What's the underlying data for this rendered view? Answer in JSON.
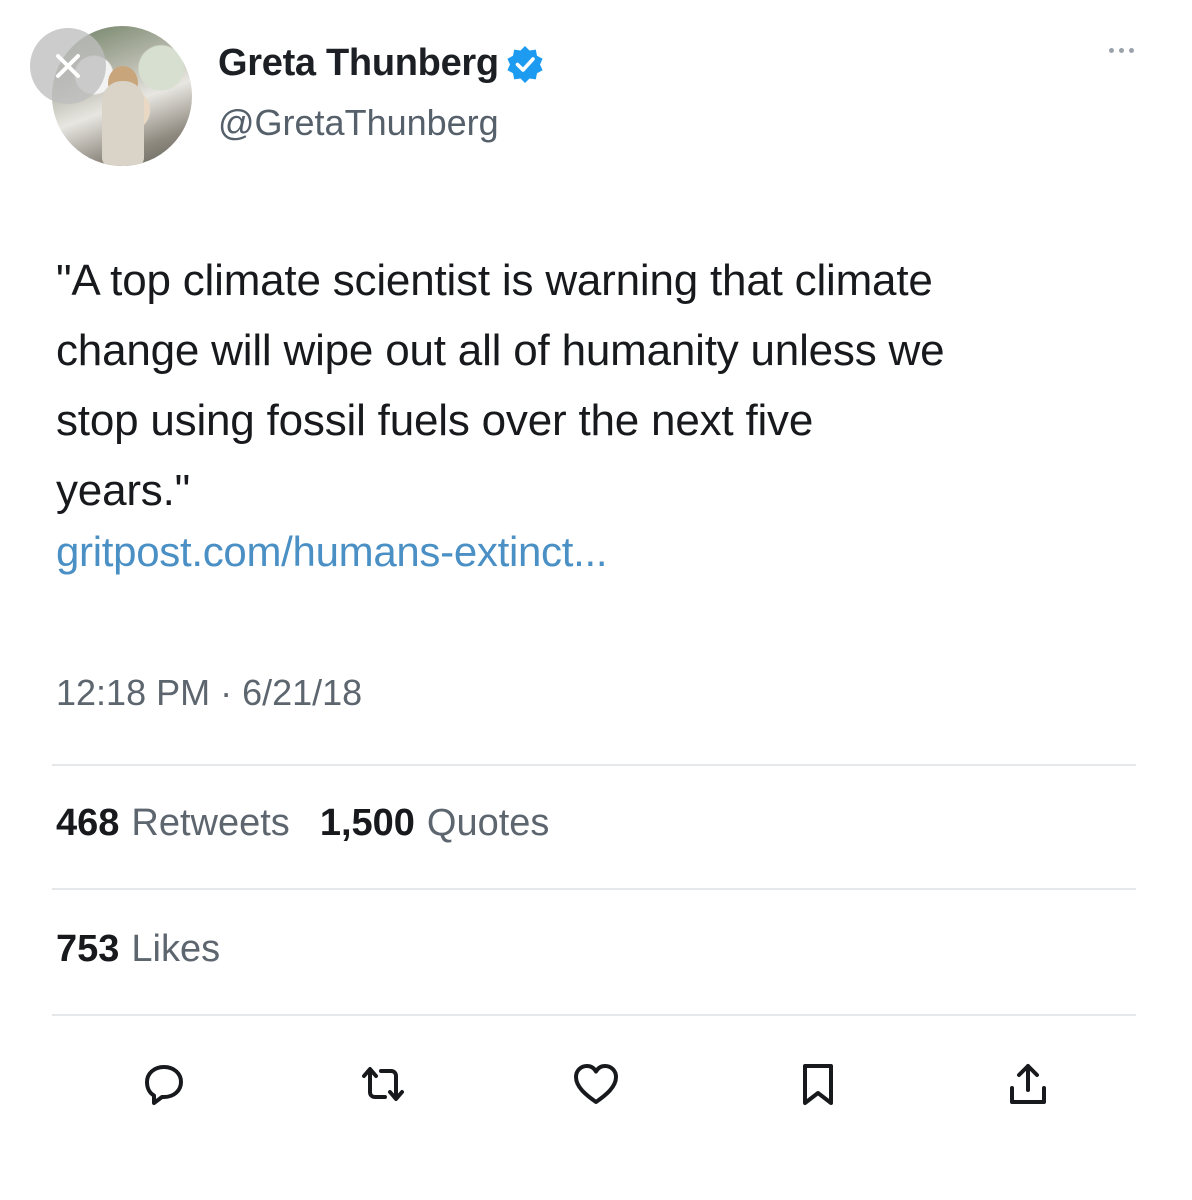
{
  "author": {
    "display_name": "Greta Thunberg",
    "handle": "@GretaThunberg",
    "verified": true
  },
  "tweet": {
    "text_lines": [
      "\"A top climate scientist is warning that climate",
      "change will wipe out all of humanity unless we",
      "stop using fossil fuels over the next five",
      "years.\""
    ],
    "link": "gritpost.com/humans-extinct...",
    "time": "12:18 PM",
    "date_separator": " · ",
    "date": "6/21/18"
  },
  "stats": {
    "retweets_count": "468",
    "retweets_label": "Retweets",
    "quotes_count": "1,500",
    "quotes_label": "Quotes",
    "likes_count": "753",
    "likes_label": "Likes"
  },
  "icons": {
    "close": "close-icon",
    "verified": "verified-badge-icon",
    "more": "more-options-icon",
    "reply": "reply-icon",
    "retweet": "retweet-icon",
    "like": "heart-icon",
    "bookmark": "bookmark-icon",
    "share": "share-icon"
  },
  "colors": {
    "link": "#4a90c5",
    "verified": "#1d9bf0",
    "muted_text": "#5d666f"
  }
}
